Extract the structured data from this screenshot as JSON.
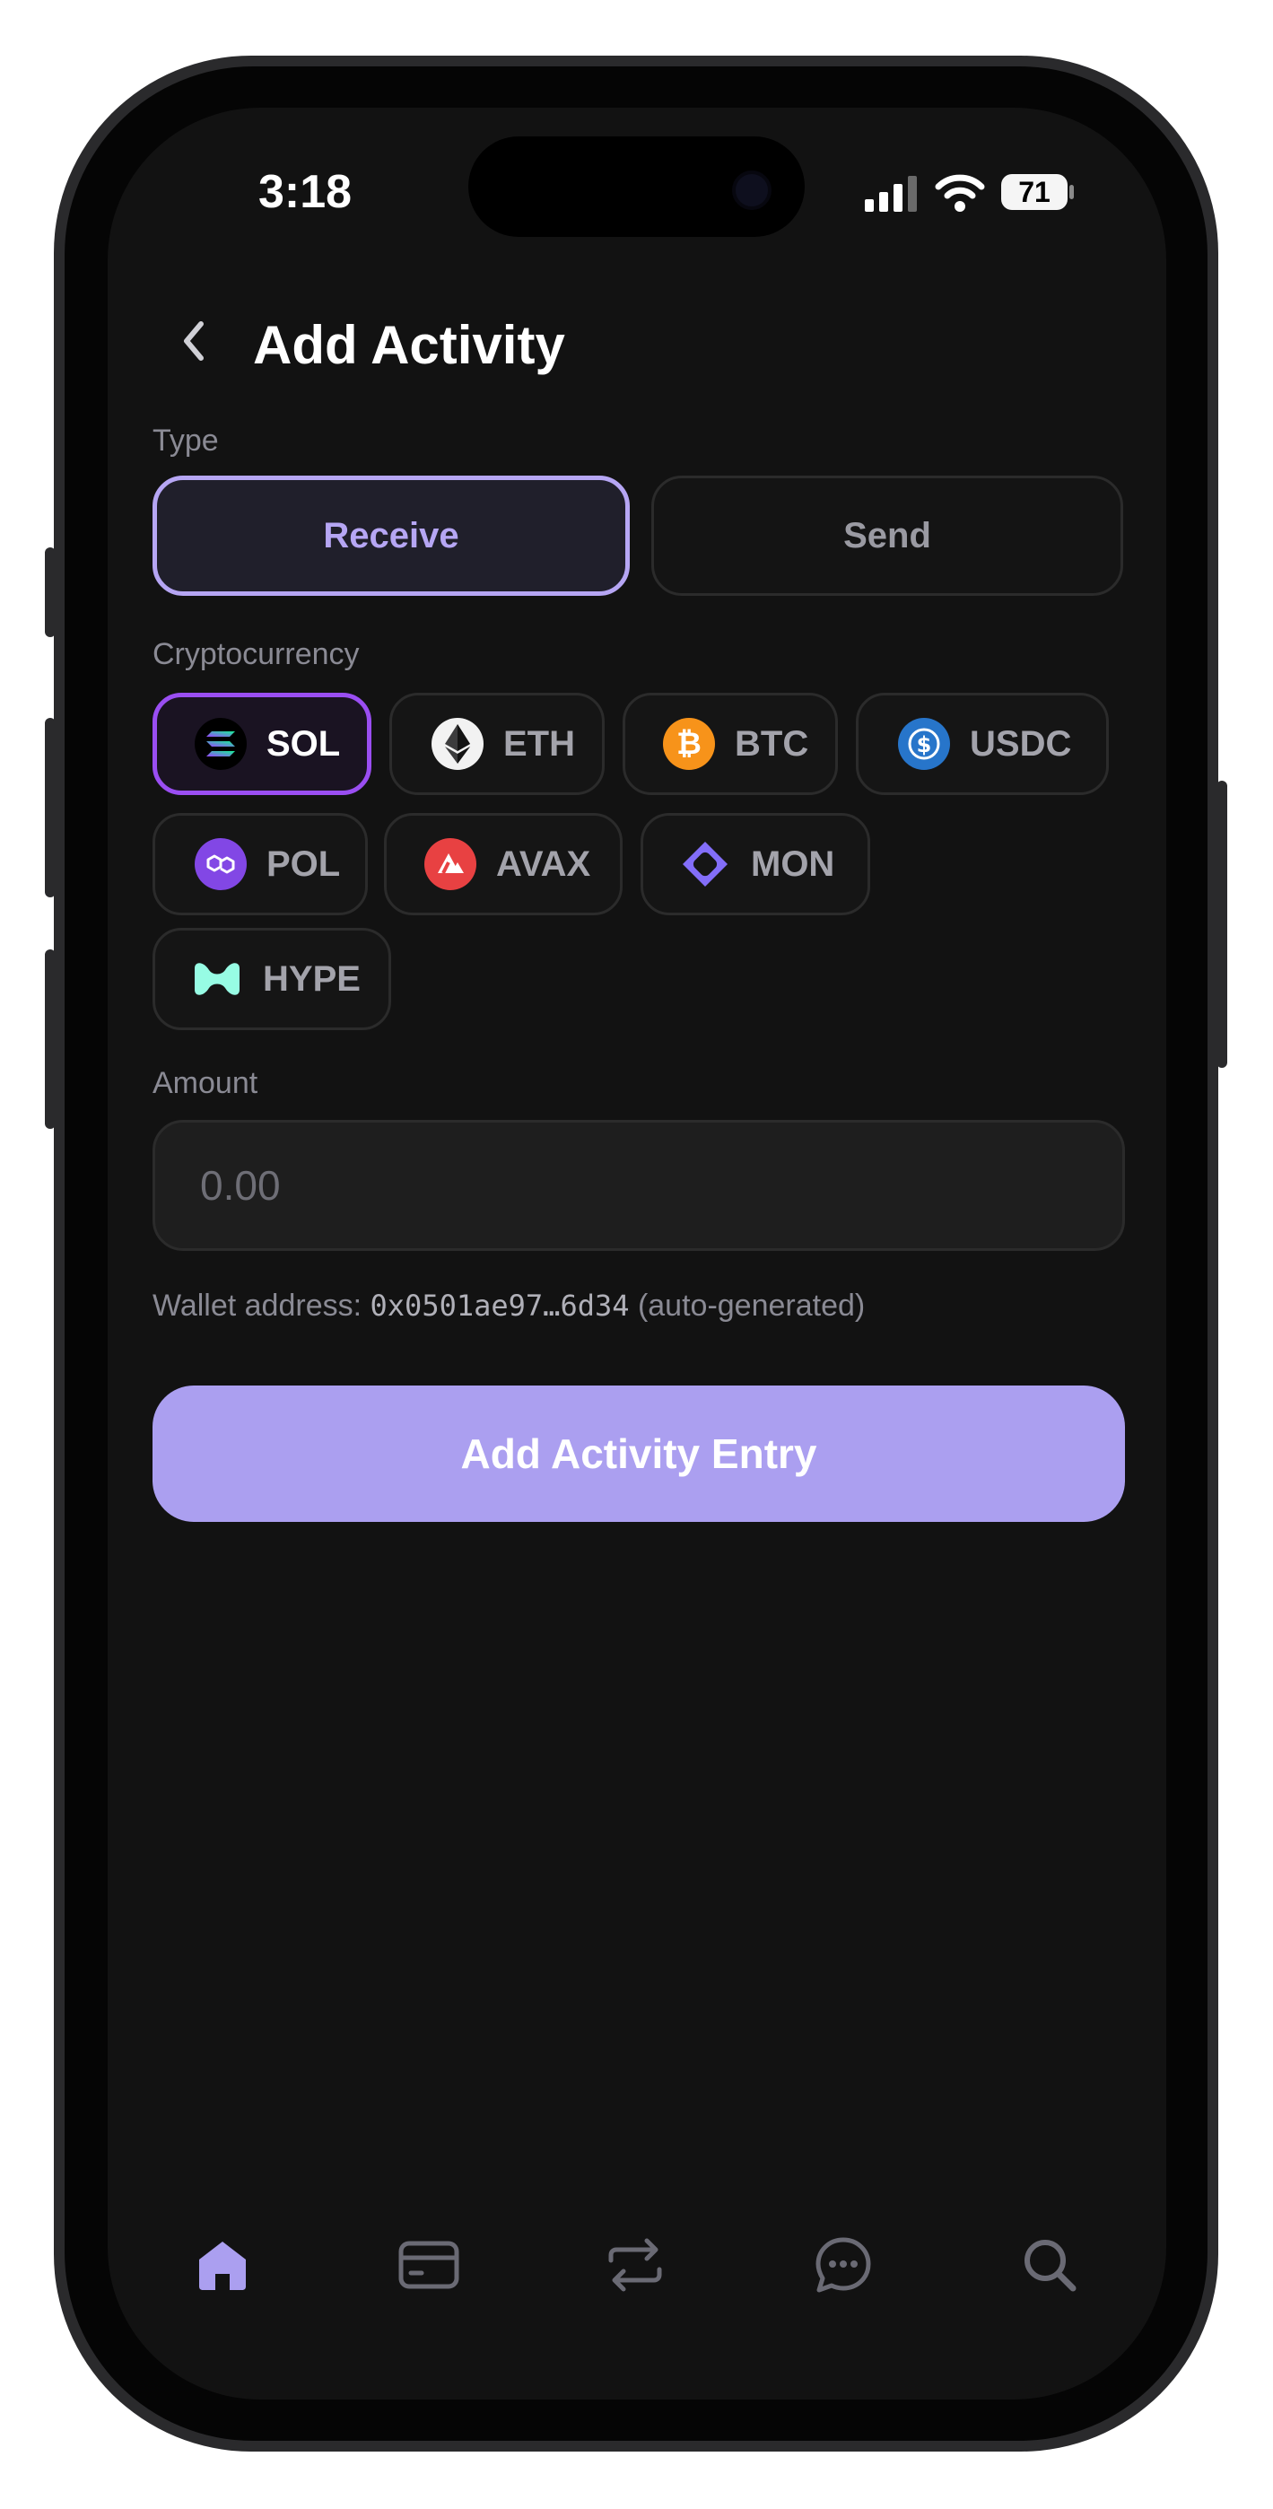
{
  "status_bar": {
    "time": "3:18",
    "battery": "71"
  },
  "header": {
    "title": "Add Activity"
  },
  "type": {
    "label": "Type",
    "options": [
      {
        "label": "Receive",
        "selected": true
      },
      {
        "label": "Send",
        "selected": false
      }
    ]
  },
  "crypto": {
    "label": "Cryptocurrency",
    "options": [
      {
        "symbol": "SOL",
        "icon": "solana-icon",
        "selected": true
      },
      {
        "symbol": "ETH",
        "icon": "ethereum-icon"
      },
      {
        "symbol": "BTC",
        "icon": "bitcoin-icon"
      },
      {
        "symbol": "USDC",
        "icon": "usdc-icon"
      },
      {
        "symbol": "POL",
        "icon": "polygon-icon"
      },
      {
        "symbol": "AVAX",
        "icon": "avalanche-icon"
      },
      {
        "symbol": "MON",
        "icon": "monad-icon"
      },
      {
        "symbol": "HYPE",
        "icon": "hyperliquid-icon"
      }
    ]
  },
  "amount": {
    "label": "Amount",
    "placeholder": "0.00"
  },
  "wallet": {
    "prefix": "Wallet address:",
    "address": "0x0501ae97…6d34",
    "suffix": "(auto-generated)"
  },
  "submit": {
    "label": "Add Activity Entry"
  },
  "bottom_nav": {
    "items": [
      "home-icon",
      "card-icon",
      "transfer-icon",
      "chat-icon",
      "search-icon"
    ],
    "active": "home-icon"
  },
  "colors": {
    "background": "#121212",
    "accent": "#ab9ff0",
    "selected_border": "#9a4ef2",
    "muted_text": "#8a8a94"
  }
}
